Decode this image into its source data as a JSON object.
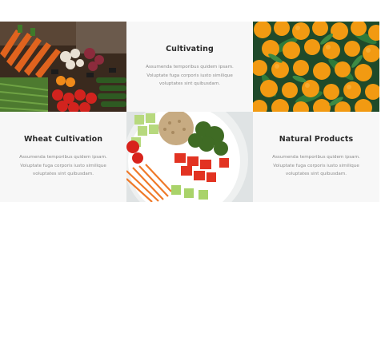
{
  "features": [
    {
      "type": "image",
      "image": "vegetable-market-stall"
    },
    {
      "type": "text",
      "title": "Cultivating",
      "description": "Assumenda temporibus quidem ipsam. Voluptate fuga corporis iusto similique voluptates sint quibusdam."
    },
    {
      "type": "image",
      "image": "oranges-with-leaves"
    },
    {
      "type": "text",
      "title": "Wheat Cultivation",
      "description": "Assumenda temporibus quidem ipsam. Voluptate fuga corporis iusto similique voluptates sint quibusdam."
    },
    {
      "type": "image",
      "image": "vegetable-salad-bowl"
    },
    {
      "type": "text",
      "title": "Natural Products",
      "description": "Assumenda temporibus quidem ipsam. Voluptate fuga corporis iusto similique voluptates sint quibusdam."
    }
  ]
}
